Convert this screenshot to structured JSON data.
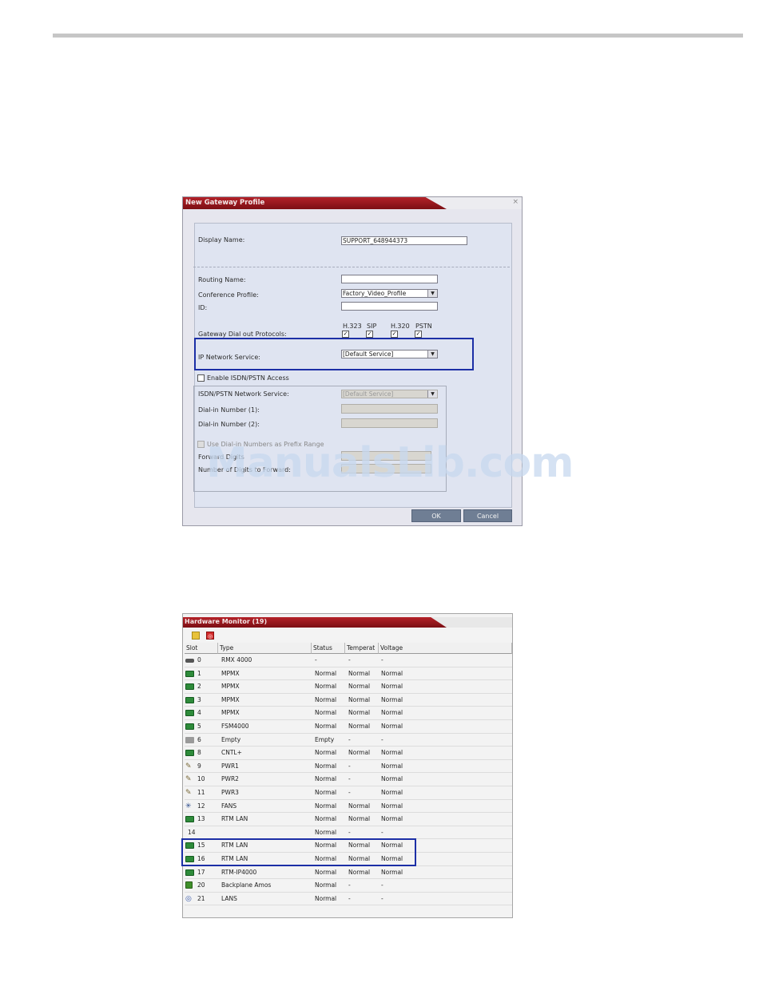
{
  "dialog": {
    "title": "New Gateway Profile",
    "close_glyph": "×",
    "display_name_label": "Display Name:",
    "display_name_value": "SUPPORT_648944373",
    "routing_name_label": "Routing Name:",
    "routing_name_value": "",
    "conference_profile_label": "Conference Profile:",
    "conference_profile_value": "Factory_Video_Profile",
    "id_label": "ID:",
    "id_value": "",
    "protocols_label": "Gateway Dial out Protocols:",
    "protocols": [
      "H.323",
      "SIP",
      "H.320",
      "PSTN"
    ],
    "protocol_checked_glyph": "✓",
    "ip_network_service_label": "IP Network Service:",
    "ip_network_service_value": "[Default Service]",
    "enable_isdn_label": "Enable ISDN/PSTN Access",
    "isdn_network_service_label": "ISDN/PSTN Network Service:",
    "isdn_network_service_value": "[Default Service]",
    "dial_in_1_label": "Dial-in Number (1):",
    "dial_in_2_label": "Dial-in Number (2):",
    "use_prefix_label": "Use Dial-in Numbers as Prefix Range",
    "forward_label": "Forward Digits",
    "number_forward_label": "Number of Digits to Forward:",
    "ok_label": "OK",
    "cancel_label": "Cancel",
    "dropdown_arrow": "▼"
  },
  "watermark": "ManualsLib.com",
  "hardware_monitor": {
    "title": "Hardware Monitor (19)",
    "columns": [
      "Slot",
      "Type",
      "Status",
      "Temperat",
      "Voltage"
    ],
    "rows": [
      {
        "slot": "0",
        "type": "RMX 4000",
        "status": "-",
        "temp": "-",
        "voltage": "-",
        "icon": "chassis-icon"
      },
      {
        "slot": "1",
        "type": "MPMX",
        "status": "Normal",
        "temp": "Normal",
        "voltage": "Normal",
        "icon": "card-icon"
      },
      {
        "slot": "2",
        "type": "MPMX",
        "status": "Normal",
        "temp": "Normal",
        "voltage": "Normal",
        "icon": "card-icon"
      },
      {
        "slot": "3",
        "type": "MPMX",
        "status": "Normal",
        "temp": "Normal",
        "voltage": "Normal",
        "icon": "card-icon"
      },
      {
        "slot": "4",
        "type": "MPMX",
        "status": "Normal",
        "temp": "Normal",
        "voltage": "Normal",
        "icon": "card-icon"
      },
      {
        "slot": "5",
        "type": "FSM4000",
        "status": "Normal",
        "temp": "Normal",
        "voltage": "Normal",
        "icon": "card-icon"
      },
      {
        "slot": "6",
        "type": "Empty",
        "status": "Empty",
        "temp": "-",
        "voltage": "-",
        "icon": "empty-slot-icon"
      },
      {
        "slot": "8",
        "type": "CNTL+",
        "status": "Normal",
        "temp": "Normal",
        "voltage": "Normal",
        "icon": "card-icon"
      },
      {
        "slot": "9",
        "type": "PWR1",
        "status": "Normal",
        "temp": "-",
        "voltage": "Normal",
        "icon": "power-icon"
      },
      {
        "slot": "10",
        "type": "PWR2",
        "status": "Normal",
        "temp": "-",
        "voltage": "Normal",
        "icon": "power-icon"
      },
      {
        "slot": "11",
        "type": "PWR3",
        "status": "Normal",
        "temp": "-",
        "voltage": "Normal",
        "icon": "power-icon"
      },
      {
        "slot": "12",
        "type": "FANS",
        "status": "Normal",
        "temp": "Normal",
        "voltage": "Normal",
        "icon": "fan-icon"
      },
      {
        "slot": "13",
        "type": "RTM LAN",
        "status": "Normal",
        "temp": "Normal",
        "voltage": "Normal",
        "icon": "card-icon"
      },
      {
        "slot": "14",
        "type": "",
        "status": "Normal",
        "temp": "-",
        "voltage": "-",
        "icon": ""
      },
      {
        "slot": "15",
        "type": "RTM LAN",
        "status": "Normal",
        "temp": "Normal",
        "voltage": "Normal",
        "icon": "card-icon"
      },
      {
        "slot": "16",
        "type": "RTM LAN",
        "status": "Normal",
        "temp": "Normal",
        "voltage": "Normal",
        "icon": "card-icon"
      },
      {
        "slot": "17",
        "type": "RTM-IP4000",
        "status": "Normal",
        "temp": "Normal",
        "voltage": "Normal",
        "icon": "card-icon"
      },
      {
        "slot": "20",
        "type": "Backplane Amos",
        "status": "Normal",
        "temp": "-",
        "voltage": "-",
        "icon": "backplane-icon"
      },
      {
        "slot": "21",
        "type": "LANS",
        "status": "Normal",
        "temp": "-",
        "voltage": "-",
        "icon": "lans-icon"
      }
    ]
  }
}
